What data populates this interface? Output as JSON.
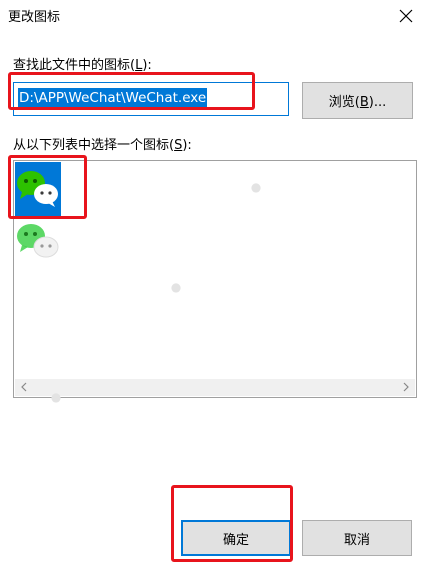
{
  "dialog": {
    "title": "更改图标",
    "close_glyph": "✕"
  },
  "path_section": {
    "label": "查找此文件中的图标(",
    "label_key": "L",
    "label_end": "):",
    "value": "D:\\APP\\WeChat\\WeChat.exe",
    "browse_label": "浏览(",
    "browse_key": "B",
    "browse_end": ")..."
  },
  "list_section": {
    "label": "从以下列表中选择一个图标(",
    "label_key": "S",
    "label_end": "):",
    "icons": [
      {
        "name": "wechat-icon",
        "selected": true
      },
      {
        "name": "wechat-icon-faded",
        "selected": false
      }
    ]
  },
  "buttons": {
    "ok": "确定",
    "cancel": "取消"
  },
  "colors": {
    "accent": "#0078d7",
    "annotation": "#e8141c",
    "wechat_green": "#2dc100"
  }
}
